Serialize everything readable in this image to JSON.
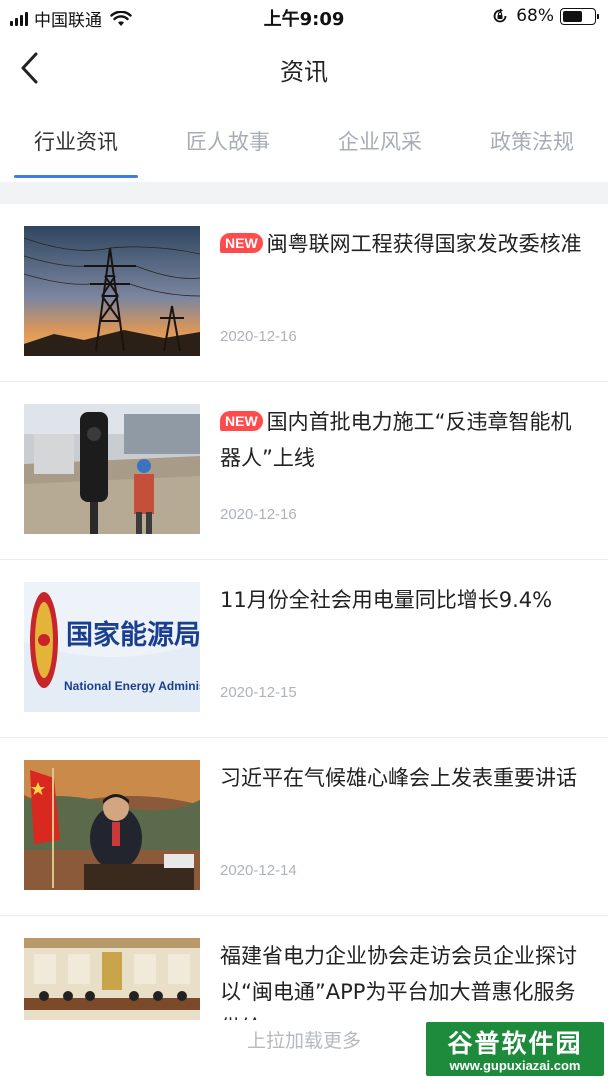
{
  "status_bar": {
    "carrier": "中国联通",
    "time": "上午9:09",
    "battery_percent": "68%",
    "battery_level": 0.68,
    "icons": [
      "signal-icon",
      "wifi-icon",
      "rotation-lock-icon",
      "battery-icon"
    ]
  },
  "nav": {
    "title": "资讯",
    "back_icon": "chevron-left-icon"
  },
  "tabs": [
    {
      "label": "行业资讯",
      "active": true
    },
    {
      "label": "匠人故事",
      "active": false
    },
    {
      "label": "企业风采",
      "active": false
    },
    {
      "label": "政策法规",
      "active": false
    }
  ],
  "news": [
    {
      "badge": "NEW",
      "title": "闽粤联网工程获得国家发改委核准",
      "date": "2020-12-16",
      "thumb": "power-tower"
    },
    {
      "badge": "NEW",
      "title": "国内首批电力施工“反违章智能机器人”上线",
      "date": "2020-12-16",
      "thumb": "robot-camera"
    },
    {
      "badge": "",
      "title": "11月份全社会用电量同比增长9.4%",
      "date": "2020-12-15",
      "thumb": "nea-logo",
      "thumb_text": "国家能源局",
      "thumb_subtext": "National Energy Administration"
    },
    {
      "badge": "",
      "title": "习近平在气候雄心峰会上发表重要讲话",
      "date": "2020-12-14",
      "thumb": "speech"
    },
    {
      "badge": "",
      "title": "福建省电力企业协会走访会员企业探讨以“闽电通”APP为平台加大普惠化服务供给",
      "date": "",
      "thumb": "meeting-room"
    }
  ],
  "load_more": "上拉加载更多",
  "watermark": {
    "brand": "谷普软件园",
    "url": "www.gupuxiazai.com"
  },
  "colors": {
    "accent": "#3d7fe0",
    "badge": "#ff4b4b",
    "watermark": "#1e8a3c"
  }
}
